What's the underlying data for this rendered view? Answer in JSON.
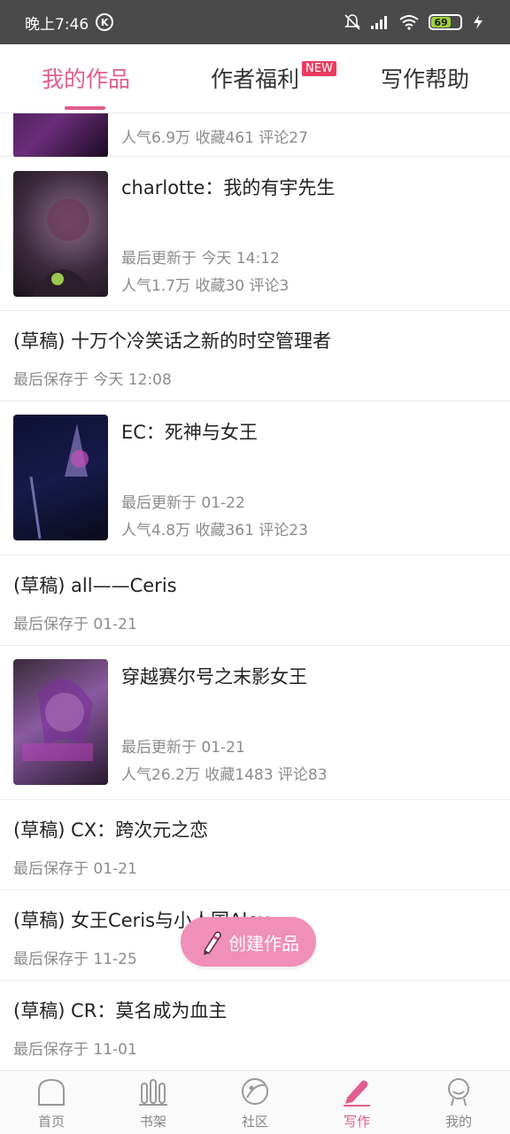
{
  "status_bar": {
    "time": "晚上7:46",
    "k_label": "K",
    "battery": "69"
  },
  "tabs": [
    {
      "label": "我的作品",
      "active": true
    },
    {
      "label": "作者福利",
      "badge": "NEW"
    },
    {
      "label": "写作帮助"
    }
  ],
  "items": [
    {
      "type": "work",
      "meta2": "人气6.9万  收藏461  评论27"
    },
    {
      "type": "work",
      "title": "charlotte：我的有宇先生",
      "meta1": "最后更新于 今天 14:12",
      "meta2": "人气1.7万  收藏30  评论3"
    },
    {
      "type": "draft",
      "title": "(草稿) 十万个冷笑话之新的时空管理者",
      "meta": "最后保存于 今天 12:08"
    },
    {
      "type": "work",
      "title": "EC：死神与女王",
      "meta1": "最后更新于 01-22",
      "meta2": "人气4.8万  收藏361  评论23"
    },
    {
      "type": "draft",
      "title": "(草稿) all——Ceris",
      "meta": "最后保存于 01-21"
    },
    {
      "type": "work",
      "title": "穿越赛尔号之末影女王",
      "meta1": "最后更新于 01-21",
      "meta2": "人气26.2万  收藏1483  评论83"
    },
    {
      "type": "draft",
      "title": "(草稿) CX：跨次元之恋",
      "meta": "最后保存于 01-21"
    },
    {
      "type": "draft",
      "title": "(草稿) 女王Ceris与小人国Alex",
      "meta": "最后保存于 11-25"
    },
    {
      "type": "draft",
      "title": "(草稿) CR：莫名成为血主",
      "meta": "最后保存于 11-01"
    }
  ],
  "fab": {
    "label": "创建作品"
  },
  "bottom_nav": [
    {
      "label": "首页",
      "icon": "home-icon"
    },
    {
      "label": "书架",
      "icon": "bookshelf-icon"
    },
    {
      "label": "社区",
      "icon": "planet-icon"
    },
    {
      "label": "写作",
      "icon": "pencil-icon",
      "active": true
    },
    {
      "label": "我的",
      "icon": "profile-icon"
    }
  ],
  "colors": {
    "accent": "#e15d8d",
    "fab": "#f08fb8",
    "badge": "#e93c5e",
    "statusbar": "#4a4a4a"
  }
}
